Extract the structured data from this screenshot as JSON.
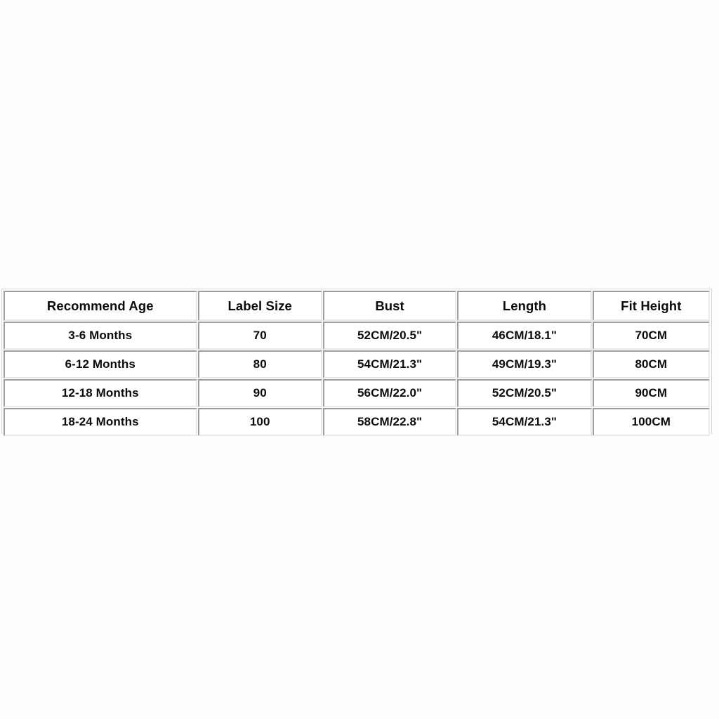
{
  "page": {
    "background_color": "#fffeff",
    "text_color": "#0b0b0b",
    "border_color": "#9e9e9e",
    "cell_background": "#ffffff"
  },
  "size_chart": {
    "columns": [
      "Recommend Age",
      "Label Size",
      "Bust",
      "Length",
      "Fit Height"
    ],
    "rows": [
      {
        "recommend_age": "3-6 Months",
        "label_size": "70",
        "bust": "52CM/20.5\"",
        "length": "46CM/18.1\"",
        "fit_height": "70CM"
      },
      {
        "recommend_age": "6-12 Months",
        "label_size": "80",
        "bust": "54CM/21.3\"",
        "length": "49CM/19.3\"",
        "fit_height": "80CM"
      },
      {
        "recommend_age": "12-18 Months",
        "label_size": "90",
        "bust": "56CM/22.0\"",
        "length": "52CM/20.5\"",
        "fit_height": "90CM"
      },
      {
        "recommend_age": "18-24 Months",
        "label_size": "100",
        "bust": "58CM/22.8\"",
        "length": "54CM/21.3\"",
        "fit_height": "100CM"
      }
    ]
  }
}
